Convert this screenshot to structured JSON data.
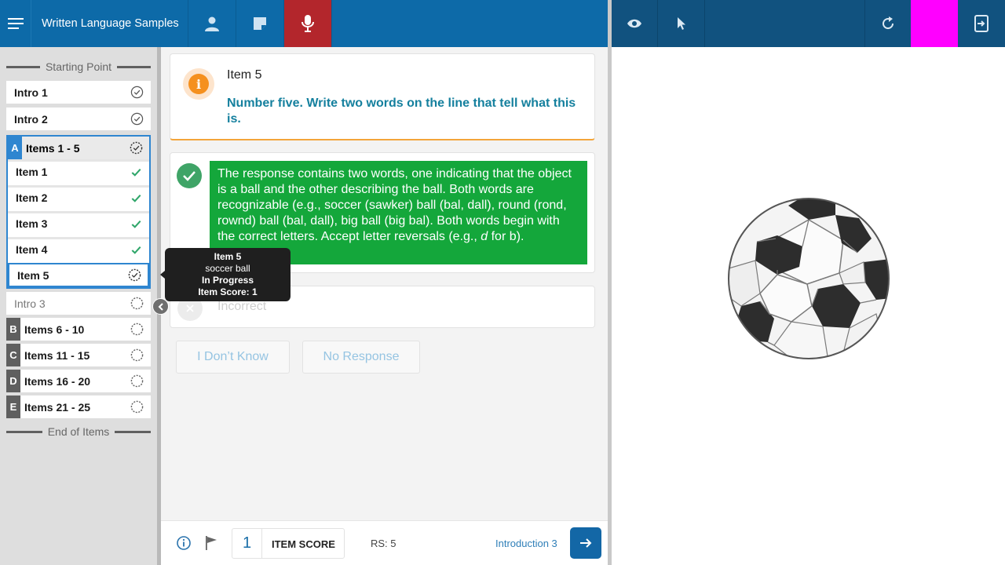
{
  "app": {
    "title": "Written Language Samples"
  },
  "topbar": {
    "left_icons": [
      "menu-icon",
      "user-icon",
      "notes-icon",
      "microphone-icon"
    ],
    "right_icons": [
      "eye-icon",
      "pointer-icon",
      "refresh-icon",
      "exit-icon"
    ],
    "colors": {
      "primary": "#0d6aa8",
      "secondary": "#11527f",
      "record": "#b3262c",
      "highlight": "#ff00ff"
    }
  },
  "sidebar": {
    "start_label": "Starting Point",
    "end_label": "End of Items",
    "intro1": "Intro 1",
    "intro2": "Intro 2",
    "intro3": "Intro 3",
    "group_a": {
      "letter": "A",
      "label": "Items 1 - 5"
    },
    "group_a_items": [
      "Item 1",
      "Item 2",
      "Item 3",
      "Item 4",
      "Item 5"
    ],
    "groups": [
      {
        "letter": "B",
        "label": "Items 6 - 10"
      },
      {
        "letter": "C",
        "label": "Items 11 - 15"
      },
      {
        "letter": "D",
        "label": "Items 16 - 20"
      },
      {
        "letter": "E",
        "label": "Items 21 - 25"
      }
    ]
  },
  "tooltip": {
    "title": "Item 5",
    "answer": "soccer ball",
    "status": "In Progress",
    "score": "Item Score: 1"
  },
  "question": {
    "title": "Item 5",
    "prompt": "Number five. Write two words on the line that tell what this is."
  },
  "correct_response": {
    "text_main": "The response contains two words, one indicating that the object is a ball and the other describing the ball. Both words are recognizable (e.g., soccer (sawker) ball (bal, dall), round (rond, rownd) ball (bal, dall), big ball (big bal). Both words begin with the correct letters. Accept letter reversals (e.g., ",
    "text_italic": "d",
    "text_tail": " for b)."
  },
  "incorrect": {
    "label": "Incorrect"
  },
  "options": {
    "dont_know": "I Don’t Know",
    "no_response": "No Response"
  },
  "footer": {
    "item_score_value": "1",
    "item_score_label": "ITEM SCORE",
    "rs": "RS: 5",
    "next_label": "Introduction 3"
  }
}
